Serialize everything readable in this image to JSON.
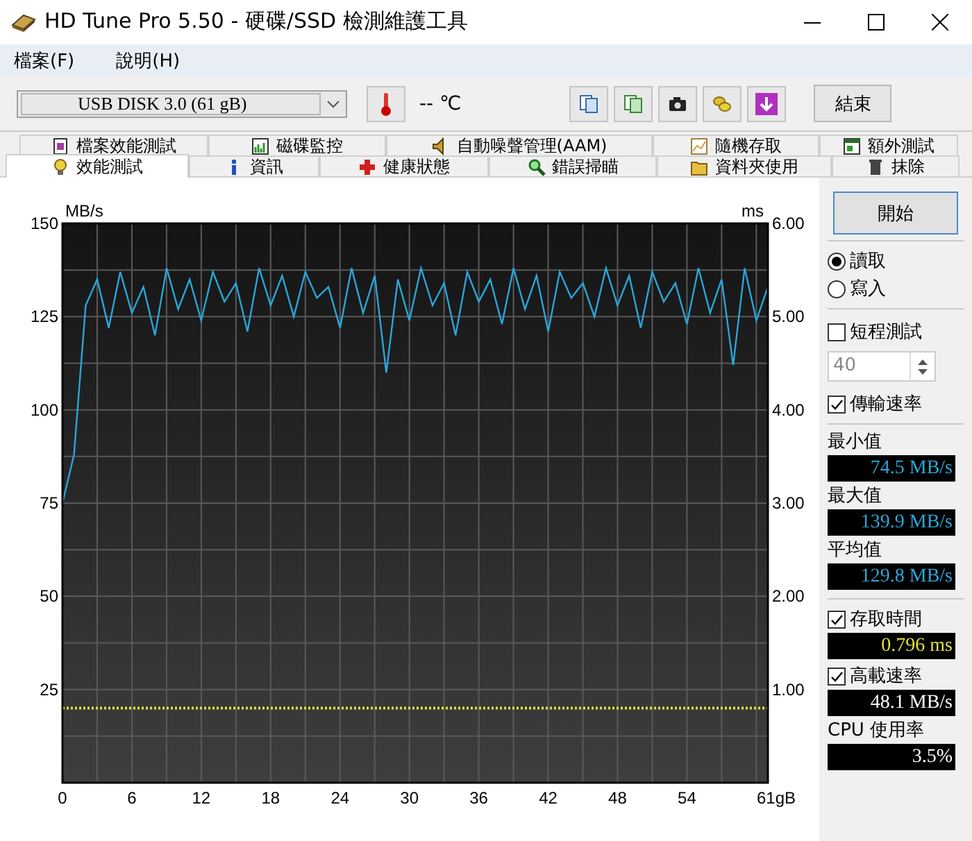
{
  "window": {
    "title": "HD Tune Pro 5.50 - 硬碟/SSD 檢測維護工具"
  },
  "menu": [
    {
      "label": "檔案(F)"
    },
    {
      "label": "說明(H)"
    }
  ],
  "toolbar": {
    "drive": {
      "value": "USB DISK 3.0 (61 gB)"
    },
    "temperature": "-- ℃",
    "exit_button": "結束"
  },
  "tabs": [
    [
      {
        "label": "檔案效能測試",
        "selected": false
      },
      {
        "label": "磁碟監控",
        "selected": false
      },
      {
        "label": "自動噪聲管理(AAM)",
        "selected": false
      },
      {
        "label": "隨機存取",
        "selected": false
      },
      {
        "label": "額外測試",
        "selected": false
      }
    ],
    [
      {
        "label": "效能測試",
        "selected": true
      },
      {
        "label": "資訊",
        "selected": false
      },
      {
        "label": "健康狀態",
        "selected": false
      },
      {
        "label": "錯誤掃瞄",
        "selected": false
      },
      {
        "label": "資料夾使用",
        "selected": false
      },
      {
        "label": "抹除",
        "selected": false
      }
    ]
  ],
  "chart": {
    "chart_data": {
      "type": "line",
      "ylabel": "MB/s",
      "y2label": "ms",
      "xlim": [
        0,
        61
      ],
      "ylim": [
        0,
        150
      ],
      "y2lim": [
        0,
        6
      ],
      "xticks": [
        0,
        6,
        12,
        18,
        24,
        30,
        36,
        42,
        48,
        54,
        {
          "value": 61,
          "label": "61gB"
        }
      ],
      "yticks": [
        25,
        50,
        75,
        100,
        125,
        150
      ],
      "y2ticks": [
        {
          "value": 1,
          "label": "1.00"
        },
        {
          "value": 2,
          "label": "2.00"
        },
        {
          "value": 3,
          "label": "3.00"
        },
        {
          "value": 4,
          "label": "4.00"
        },
        {
          "value": 5,
          "label": "5.00"
        },
        {
          "value": 6,
          "label": "6.00"
        }
      ],
      "x": [
        0,
        1,
        2,
        3,
        4,
        5,
        6,
        7,
        8,
        9,
        10,
        11,
        12,
        13,
        14,
        15,
        16,
        17,
        18,
        19,
        20,
        21,
        22,
        23,
        24,
        25,
        26,
        27,
        28,
        29,
        30,
        31,
        32,
        33,
        34,
        35,
        36,
        37,
        38,
        39,
        40,
        41,
        42,
        43,
        44,
        45,
        46,
        47,
        48,
        49,
        50,
        51,
        52,
        53,
        54,
        55,
        56,
        57,
        58,
        59,
        60,
        61
      ],
      "grid": true,
      "series": [
        {
          "color": "#2aa6d8",
          "line_style": "solid",
          "values": [
            75,
            88,
            128,
            135,
            122,
            137,
            126,
            133,
            120,
            138,
            127,
            135,
            124,
            137,
            129,
            134,
            121,
            138,
            128,
            136,
            125,
            137,
            130,
            133,
            122,
            138,
            126,
            136,
            110,
            135,
            124,
            138,
            128,
            134,
            120,
            137,
            129,
            135,
            123,
            138,
            127,
            136,
            121,
            137,
            130,
            134,
            125,
            138,
            128,
            136,
            122,
            137,
            129,
            134,
            123,
            138,
            126,
            135,
            112,
            138,
            124,
            133
          ]
        },
        {
          "color": "#e0e040",
          "axis": "y2",
          "line_style": "dotted",
          "values": [
            0.8,
            0.8,
            0.8,
            0.8,
            0.8,
            0.8,
            0.8,
            0.8,
            0.8,
            0.8,
            0.8,
            0.8,
            0.8,
            0.8,
            0.8,
            0.8,
            0.8,
            0.8,
            0.8,
            0.8,
            0.8,
            0.8,
            0.8,
            0.8,
            0.8,
            0.8,
            0.8,
            0.8,
            0.8,
            0.8,
            0.8,
            0.8,
            0.8,
            0.8,
            0.8,
            0.8,
            0.8,
            0.8,
            0.8,
            0.8,
            0.8,
            0.8,
            0.8,
            0.8,
            0.8,
            0.8,
            0.8,
            0.8,
            0.8,
            0.8,
            0.8,
            0.8,
            0.8,
            0.8,
            0.8,
            0.8,
            0.8,
            0.8,
            0.8,
            0.8,
            0.8,
            0.8
          ]
        }
      ]
    }
  },
  "panel": {
    "start_button": "開始",
    "modes": [
      {
        "label": "讀取",
        "selected": true
      },
      {
        "label": "寫入",
        "selected": false
      }
    ],
    "short_test": {
      "label": "短程測試",
      "checked": false
    },
    "short_test_size": {
      "value": "40",
      "disabled": true
    },
    "items": [
      {
        "kind": "check",
        "label": "傳輸速率",
        "checked": true
      },
      {
        "kind": "divider"
      },
      {
        "kind": "label",
        "label": "最小值"
      },
      {
        "kind": "value",
        "value": "74.5 MB/s",
        "color": "#2aa6d8"
      },
      {
        "kind": "label",
        "label": "最大值"
      },
      {
        "kind": "value",
        "value": "139.9 MB/s",
        "color": "#2aa6d8"
      },
      {
        "kind": "label",
        "label": "平均值"
      },
      {
        "kind": "value",
        "value": "129.8 MB/s",
        "color": "#2aa6d8"
      },
      {
        "kind": "divider"
      },
      {
        "kind": "check",
        "label": "存取時間",
        "checked": true
      },
      {
        "kind": "value",
        "value": "0.796 ms",
        "color": "#e0e040"
      },
      {
        "kind": "check",
        "label": "高載速率",
        "checked": true
      },
      {
        "kind": "value",
        "value": "48.1 MB/s",
        "color": "#ffffff"
      },
      {
        "kind": "label",
        "label": "CPU 使用率"
      },
      {
        "kind": "value",
        "value": "3.5%",
        "color": "#ffffff"
      }
    ]
  }
}
